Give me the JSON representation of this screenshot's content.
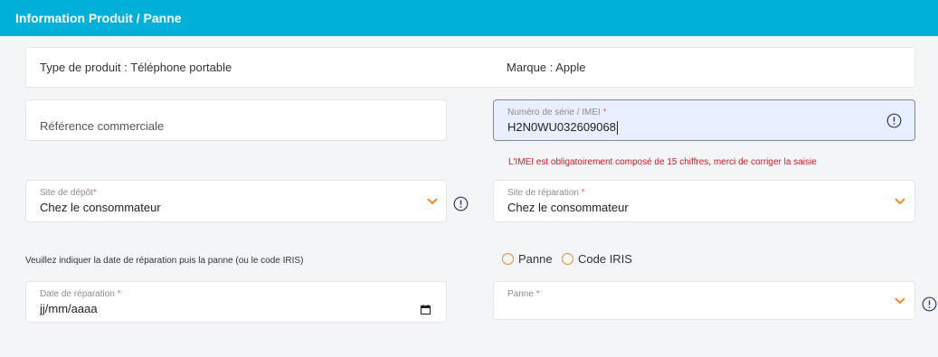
{
  "header": {
    "title": "Information Produit / Panne"
  },
  "product": {
    "type_text": "Type de produit : Téléphone portable",
    "brand_text": "Marque : Apple"
  },
  "fields": {
    "commercial_ref": {
      "placeholder": "Référence commerciale"
    },
    "serial": {
      "label": "Numéro de série / IMEI",
      "required_mark": "*",
      "value": "H2N0WU032609068"
    },
    "serial_error": "L'IMEI est obligatoirement composé de 15 chiffres, merci de corriger la saisie",
    "deposit_site": {
      "label": "Site de dépôt",
      "required_mark": "*",
      "value": "Chez le consommateur"
    },
    "repair_site": {
      "label": "Site de réparation",
      "required_mark": "*",
      "value": "Chez le consommateur"
    },
    "instruction": "Veuillez indiquer la date de réparation puis la panne (ou le code IRIS)",
    "radio_panne": "Panne",
    "radio_iris": "Code IRIS",
    "repair_date": {
      "label": "Date de réparation",
      "required_mark": "*",
      "value": "jj/mm/aaaa"
    },
    "panne": {
      "label": "Panne",
      "required_mark": "*",
      "value": ""
    }
  },
  "icons": {
    "chevron": "chevron-down-icon",
    "info": "info-icon",
    "calendar": "calendar-icon"
  },
  "colors": {
    "header_bg": "#00b0d8",
    "accent_orange": "#f08a2c",
    "error_red": "#d9171f",
    "active_field_bg": "#e8efff",
    "icon_navy": "#2c3e66"
  }
}
